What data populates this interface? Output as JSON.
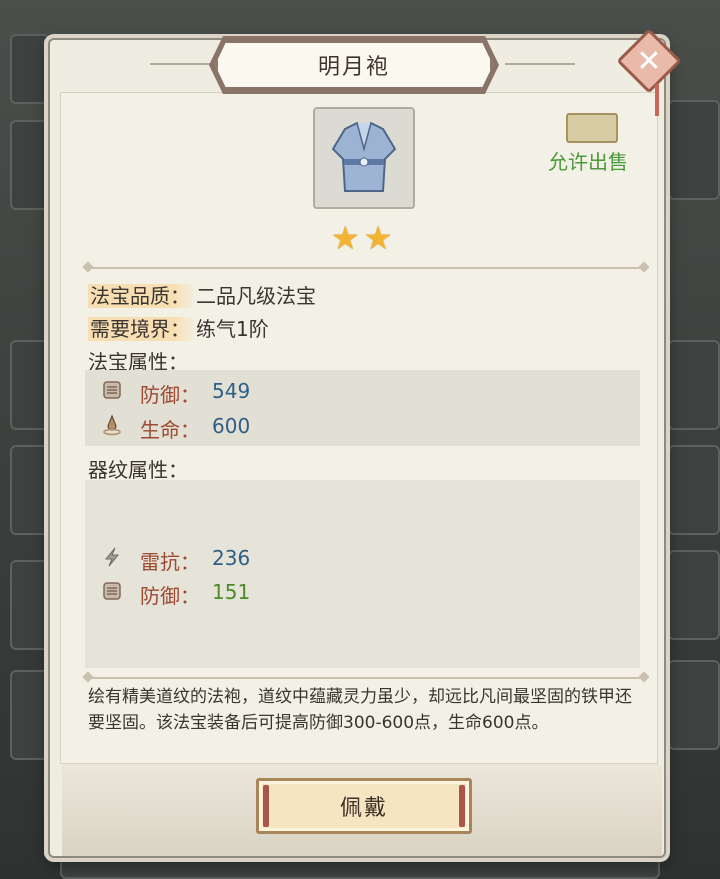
{
  "title": "明月袍",
  "close_icon": "close-icon",
  "item_icon": "robe-icon",
  "stars": 2,
  "sell": {
    "label": "允许出售",
    "icon": "chest-icon"
  },
  "quality": {
    "label": "法宝品质：",
    "value": "二品凡级法宝"
  },
  "realm": {
    "label": "需要境界：",
    "value": "练气1阶"
  },
  "base_attrs": {
    "header": "法宝属性：",
    "items": [
      {
        "icon": "shield-icon",
        "name": "防御：",
        "value": "549"
      },
      {
        "icon": "droplet-icon",
        "name": "生命：",
        "value": "600"
      }
    ]
  },
  "pattern_attrs": {
    "header": "器纹属性：",
    "items": [
      {
        "icon": "lightning-icon",
        "name": "雷抗：",
        "value": "236"
      },
      {
        "icon": "shield-icon",
        "name": "防御：",
        "value": "151"
      }
    ]
  },
  "description": "绘有精美道纹的法袍，道纹中蕴藏灵力虽少，却远比凡间最坚固的铁甲还要坚固。该法宝装备后可提高防御300-600点，生命600点。",
  "wear_button": "佩戴",
  "colors": {
    "accent_green": "#4a9a3c",
    "value_blue": "#2f5f86",
    "attr_red": "#9c4a32",
    "star": "#f2b431"
  }
}
